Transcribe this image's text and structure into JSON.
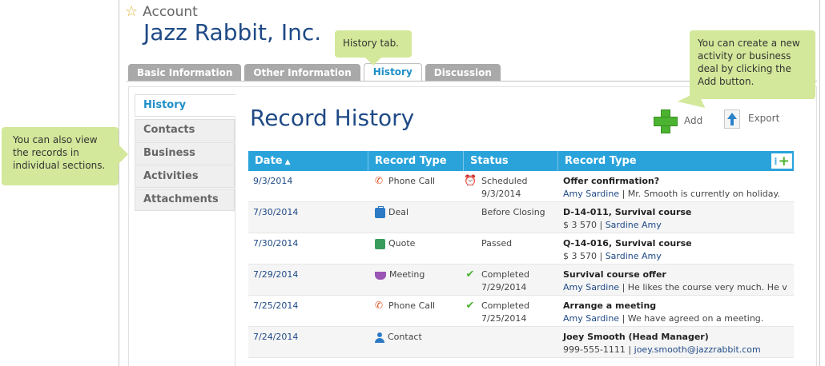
{
  "account": {
    "label": "Account",
    "company": "Jazz Rabbit, Inc."
  },
  "tabs": [
    {
      "label": "Basic Information"
    },
    {
      "label": "Other Information"
    },
    {
      "label": "History"
    },
    {
      "label": "Discussion"
    }
  ],
  "sidebar": {
    "items": [
      {
        "label": "History"
      },
      {
        "label": "Contacts"
      },
      {
        "label": "Business"
      },
      {
        "label": "Activities"
      },
      {
        "label": "Attachments"
      }
    ]
  },
  "main": {
    "title": "Record History",
    "add_label": "Add",
    "export_label": "Export"
  },
  "table": {
    "headers": [
      "Date",
      "Record Type",
      "Status",
      "Record Type"
    ],
    "rows": [
      {
        "date": "9/3/2014",
        "type": "Phone Call",
        "status": "Scheduled",
        "status_date": "9/3/2014",
        "title": "Offer confirmation?",
        "link": "Amy Sardine",
        "detail": "Mr. Smooth is currently on holiday."
      },
      {
        "date": "7/30/2014",
        "type": "Deal",
        "status": "Before Closing",
        "status_date": "",
        "title": "D-14-011, Survival course",
        "link": "Sardine Amy",
        "detail": "$ 3 570"
      },
      {
        "date": "7/30/2014",
        "type": "Quote",
        "status": "Passed",
        "status_date": "",
        "title": "Q-14-016, Survival course",
        "link": "Sardine Amy",
        "detail": "$ 3 570"
      },
      {
        "date": "7/29/2014",
        "type": "Meeting",
        "status": "Completed",
        "status_date": "7/29/2014",
        "title": "Survival course offer",
        "link": "Amy Sardine",
        "detail": "He likes the course very much. He v"
      },
      {
        "date": "7/25/2014",
        "type": "Phone Call",
        "status": "Completed",
        "status_date": "7/25/2014",
        "title": "Arrange a meeting",
        "link": "Amy Sardine",
        "detail": "We have agreed on a meeting."
      },
      {
        "date": "7/24/2014",
        "type": "Contact",
        "status": "",
        "status_date": "",
        "title": "Joey Smooth (Head Manager)",
        "link": "joey.smooth@jazzrabbit.com",
        "detail": "999-555-1111"
      }
    ]
  },
  "callouts": {
    "history_tab": "History tab.",
    "add": "You can create a new activity or business deal by clicking the Add button.",
    "sections": "You can also view the records in individual sections."
  },
  "colors": {
    "accent": "#2aa3db",
    "title": "#1f4a86",
    "callout": "#d3e89a",
    "add_green": "#4bb330"
  }
}
